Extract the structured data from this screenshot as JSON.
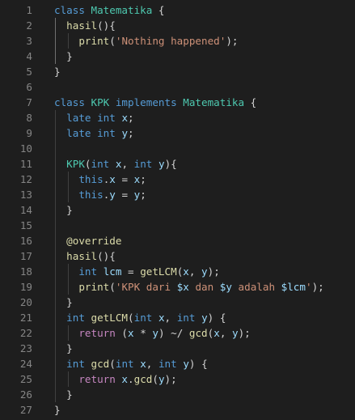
{
  "editor": {
    "lines": [
      {
        "n": "1",
        "tokens": [
          [
            "kw",
            "class "
          ],
          [
            "cls",
            "Matematika"
          ],
          [
            "punc",
            " {"
          ]
        ]
      },
      {
        "n": "2",
        "tokens": [
          [
            "fn",
            "hasil"
          ],
          [
            "punc",
            "(){"
          ]
        ]
      },
      {
        "n": "3",
        "tokens": [
          [
            "fn",
            "print"
          ],
          [
            "punc",
            "("
          ],
          [
            "str",
            "'Nothing happened'"
          ],
          [
            "punc",
            ");"
          ]
        ]
      },
      {
        "n": "4",
        "tokens": [
          [
            "punc",
            "}"
          ]
        ]
      },
      {
        "n": "5",
        "tokens": [
          [
            "punc",
            "}"
          ]
        ]
      },
      {
        "n": "6",
        "tokens": []
      },
      {
        "n": "7",
        "tokens": [
          [
            "kw",
            "class "
          ],
          [
            "cls",
            "KPK"
          ],
          [
            "kw",
            " implements "
          ],
          [
            "cls",
            "Matematika"
          ],
          [
            "punc",
            " {"
          ]
        ]
      },
      {
        "n": "8",
        "tokens": [
          [
            "kw",
            "late "
          ],
          [
            "kw",
            "int "
          ],
          [
            "id",
            "x"
          ],
          [
            "punc",
            ";"
          ]
        ]
      },
      {
        "n": "9",
        "tokens": [
          [
            "kw",
            "late "
          ],
          [
            "kw",
            "int "
          ],
          [
            "id",
            "y"
          ],
          [
            "punc",
            ";"
          ]
        ]
      },
      {
        "n": "10",
        "tokens": []
      },
      {
        "n": "11",
        "tokens": [
          [
            "cls",
            "KPK"
          ],
          [
            "punc",
            "("
          ],
          [
            "kw",
            "int "
          ],
          [
            "id",
            "x"
          ],
          [
            "punc",
            ", "
          ],
          [
            "kw",
            "int "
          ],
          [
            "id",
            "y"
          ],
          [
            "punc",
            "){"
          ]
        ]
      },
      {
        "n": "12",
        "tokens": [
          [
            "kw",
            "this"
          ],
          [
            "punc",
            "."
          ],
          [
            "id",
            "x"
          ],
          [
            "punc",
            " = "
          ],
          [
            "id",
            "x"
          ],
          [
            "punc",
            ";"
          ]
        ]
      },
      {
        "n": "13",
        "tokens": [
          [
            "kw",
            "this"
          ],
          [
            "punc",
            "."
          ],
          [
            "id",
            "y"
          ],
          [
            "punc",
            " = "
          ],
          [
            "id",
            "y"
          ],
          [
            "punc",
            ";"
          ]
        ]
      },
      {
        "n": "14",
        "tokens": [
          [
            "punc",
            "}"
          ]
        ]
      },
      {
        "n": "15",
        "tokens": []
      },
      {
        "n": "16",
        "tokens": [
          [
            "ann",
            "@override"
          ]
        ]
      },
      {
        "n": "17",
        "tokens": [
          [
            "fn",
            "hasil"
          ],
          [
            "punc",
            "(){"
          ]
        ]
      },
      {
        "n": "18",
        "tokens": [
          [
            "kw",
            "int "
          ],
          [
            "id",
            "lcm"
          ],
          [
            "punc",
            " = "
          ],
          [
            "fn",
            "getLCM"
          ],
          [
            "punc",
            "("
          ],
          [
            "id",
            "x"
          ],
          [
            "punc",
            ", "
          ],
          [
            "id",
            "y"
          ],
          [
            "punc",
            ");"
          ]
        ]
      },
      {
        "n": "19",
        "tokens": [
          [
            "fn",
            "print"
          ],
          [
            "punc",
            "("
          ],
          [
            "str",
            "'KPK dari "
          ],
          [
            "id",
            "$x"
          ],
          [
            "str",
            " dan "
          ],
          [
            "id",
            "$y"
          ],
          [
            "str",
            " adalah "
          ],
          [
            "id",
            "$lcm"
          ],
          [
            "str",
            "'"
          ],
          [
            "punc",
            ");"
          ]
        ]
      },
      {
        "n": "20",
        "tokens": [
          [
            "punc",
            "}"
          ]
        ]
      },
      {
        "n": "21",
        "tokens": [
          [
            "kw",
            "int "
          ],
          [
            "fn",
            "getLCM"
          ],
          [
            "punc",
            "("
          ],
          [
            "kw",
            "int "
          ],
          [
            "id",
            "x"
          ],
          [
            "punc",
            ", "
          ],
          [
            "kw",
            "int "
          ],
          [
            "id",
            "y"
          ],
          [
            "punc",
            ") {"
          ]
        ]
      },
      {
        "n": "22",
        "tokens": [
          [
            "ctl",
            "return "
          ],
          [
            "punc",
            "("
          ],
          [
            "id",
            "x"
          ],
          [
            "punc",
            " * "
          ],
          [
            "id",
            "y"
          ],
          [
            "punc",
            ") ~/ "
          ],
          [
            "fn",
            "gcd"
          ],
          [
            "punc",
            "("
          ],
          [
            "id",
            "x"
          ],
          [
            "punc",
            ", "
          ],
          [
            "id",
            "y"
          ],
          [
            "punc",
            ");"
          ]
        ]
      },
      {
        "n": "23",
        "tokens": [
          [
            "punc",
            "}"
          ]
        ]
      },
      {
        "n": "24",
        "tokens": [
          [
            "kw",
            "int "
          ],
          [
            "fn",
            "gcd"
          ],
          [
            "punc",
            "("
          ],
          [
            "kw",
            "int "
          ],
          [
            "id",
            "x"
          ],
          [
            "punc",
            ", "
          ],
          [
            "kw",
            "int "
          ],
          [
            "id",
            "y"
          ],
          [
            "punc",
            ") {"
          ]
        ]
      },
      {
        "n": "25",
        "tokens": [
          [
            "ctl",
            "return "
          ],
          [
            "id",
            "x"
          ],
          [
            "punc",
            "."
          ],
          [
            "fn",
            "gcd"
          ],
          [
            "punc",
            "("
          ],
          [
            "id",
            "y"
          ],
          [
            "punc",
            ");"
          ]
        ]
      },
      {
        "n": "26",
        "tokens": [
          [
            "punc",
            "}"
          ]
        ]
      },
      {
        "n": "27",
        "tokens": [
          [
            "punc",
            "}"
          ]
        ]
      }
    ]
  }
}
